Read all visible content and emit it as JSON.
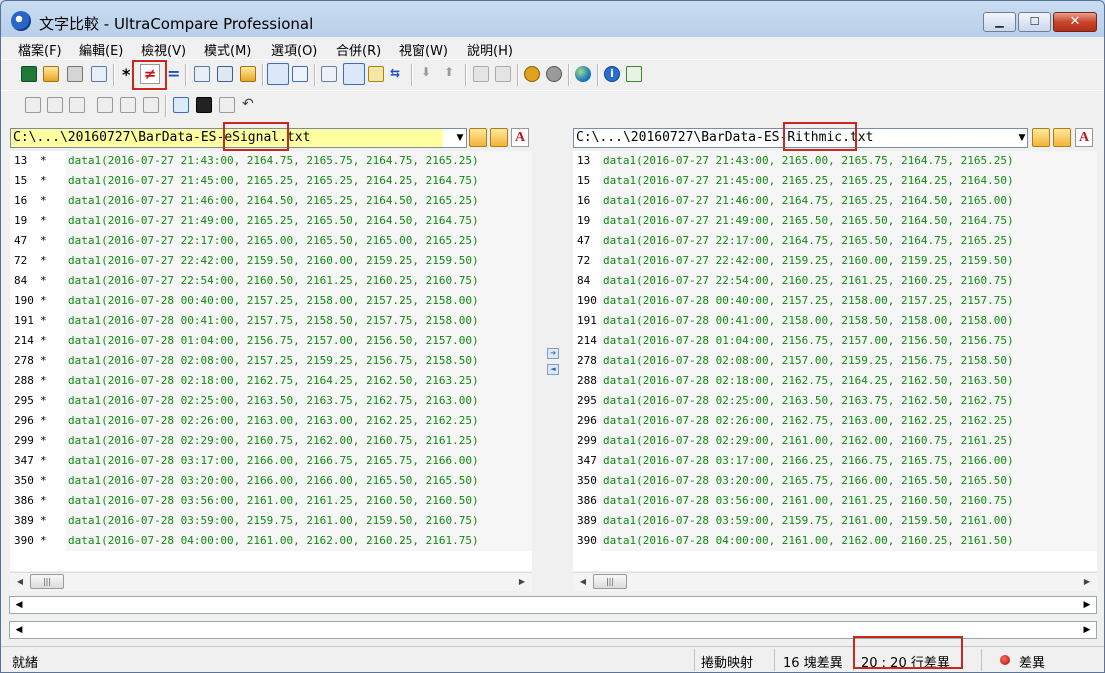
{
  "window": {
    "title": "文字比較 - UltraCompare Professional"
  },
  "menu": [
    "檔案(F)",
    "編輯(E)",
    "檢視(V)",
    "模式(M)",
    "選項(O)",
    "合併(R)",
    "視窗(W)",
    "說明(H)"
  ],
  "left_pane": {
    "path": "C:\\...\\20160727\\BarData-ES-eSignal.txt",
    "rows": [
      {
        "line": "13",
        "mark": "*",
        "text": "data1(2016-07-27 21:43:00, 2164.75, 2165.75, 2164.75, 2165.25)"
      },
      {
        "line": "15",
        "mark": "*",
        "text": "data1(2016-07-27 21:45:00, 2165.25, 2165.25, 2164.25, 2164.75)"
      },
      {
        "line": "16",
        "mark": "*",
        "text": "data1(2016-07-27 21:46:00, 2164.50, 2165.25, 2164.50, 2165.25)"
      },
      {
        "line": "19",
        "mark": "*",
        "text": "data1(2016-07-27 21:49:00, 2165.25, 2165.50, 2164.50, 2164.75)"
      },
      {
        "line": "47",
        "mark": "*",
        "text": "data1(2016-07-27 22:17:00, 2165.00, 2165.50, 2165.00, 2165.25)"
      },
      {
        "line": "72",
        "mark": "*",
        "text": "data1(2016-07-27 22:42:00, 2159.50, 2160.00, 2159.25, 2159.50)"
      },
      {
        "line": "84",
        "mark": "*",
        "text": "data1(2016-07-27 22:54:00, 2160.50, 2161.25, 2160.25, 2160.75)"
      },
      {
        "line": "190",
        "mark": "*",
        "text": "data1(2016-07-28 00:40:00, 2157.25, 2158.00, 2157.25, 2158.00)"
      },
      {
        "line": "191",
        "mark": "*",
        "text": "data1(2016-07-28 00:41:00, 2157.75, 2158.50, 2157.75, 2158.00)"
      },
      {
        "line": "214",
        "mark": "*",
        "text": "data1(2016-07-28 01:04:00, 2156.75, 2157.00, 2156.50, 2157.00)"
      },
      {
        "line": "278",
        "mark": "*",
        "text": "data1(2016-07-28 02:08:00, 2157.25, 2159.25, 2156.75, 2158.50)"
      },
      {
        "line": "288",
        "mark": "*",
        "text": "data1(2016-07-28 02:18:00, 2162.75, 2164.25, 2162.50, 2163.25)"
      },
      {
        "line": "295",
        "mark": "*",
        "text": "data1(2016-07-28 02:25:00, 2163.50, 2163.75, 2162.75, 2163.00)"
      },
      {
        "line": "296",
        "mark": "*",
        "text": "data1(2016-07-28 02:26:00, 2163.00, 2163.00, 2162.25, 2162.25)"
      },
      {
        "line": "299",
        "mark": "*",
        "text": "data1(2016-07-28 02:29:00, 2160.75, 2162.00, 2160.75, 2161.25)"
      },
      {
        "line": "347",
        "mark": "*",
        "text": "data1(2016-07-28 03:17:00, 2166.00, 2166.75, 2165.75, 2166.00)"
      },
      {
        "line": "350",
        "mark": "*",
        "text": "data1(2016-07-28 03:20:00, 2166.00, 2166.00, 2165.50, 2165.50)"
      },
      {
        "line": "386",
        "mark": "*",
        "text": "data1(2016-07-28 03:56:00, 2161.00, 2161.25, 2160.50, 2160.50)"
      },
      {
        "line": "389",
        "mark": "*",
        "text": "data1(2016-07-28 03:59:00, 2159.75, 2161.00, 2159.50, 2160.75)"
      },
      {
        "line": "390",
        "mark": "*",
        "text": "data1(2016-07-28 04:00:00, 2161.00, 2162.00, 2160.25, 2161.75)"
      }
    ]
  },
  "right_pane": {
    "path": "C:\\...\\20160727\\BarData-ES-Rithmic.txt",
    "rows": [
      {
        "line": "13",
        "text": "data1(2016-07-27 21:43:00, 2165.00, 2165.75, 2164.75, 2165.25)"
      },
      {
        "line": "15",
        "text": "data1(2016-07-27 21:45:00, 2165.25, 2165.25, 2164.25, 2164.50)"
      },
      {
        "line": "16",
        "text": "data1(2016-07-27 21:46:00, 2164.75, 2165.25, 2164.50, 2165.00)"
      },
      {
        "line": "19",
        "text": "data1(2016-07-27 21:49:00, 2165.50, 2165.50, 2164.50, 2164.75)"
      },
      {
        "line": "47",
        "text": "data1(2016-07-27 22:17:00, 2164.75, 2165.50, 2164.75, 2165.25)"
      },
      {
        "line": "72",
        "text": "data1(2016-07-27 22:42:00, 2159.25, 2160.00, 2159.25, 2159.50)"
      },
      {
        "line": "84",
        "text": "data1(2016-07-27 22:54:00, 2160.25, 2161.25, 2160.25, 2160.75)"
      },
      {
        "line": "190",
        "text": "data1(2016-07-28 00:40:00, 2157.25, 2158.00, 2157.25, 2157.75)"
      },
      {
        "line": "191",
        "text": "data1(2016-07-28 00:41:00, 2158.00, 2158.50, 2158.00, 2158.00)"
      },
      {
        "line": "214",
        "text": "data1(2016-07-28 01:04:00, 2156.75, 2157.00, 2156.50, 2156.75)"
      },
      {
        "line": "278",
        "text": "data1(2016-07-28 02:08:00, 2157.00, 2159.25, 2156.75, 2158.50)"
      },
      {
        "line": "288",
        "text": "data1(2016-07-28 02:18:00, 2162.75, 2164.25, 2162.50, 2163.50)"
      },
      {
        "line": "295",
        "text": "data1(2016-07-28 02:25:00, 2163.50, 2163.75, 2162.50, 2162.75)"
      },
      {
        "line": "296",
        "text": "data1(2016-07-28 02:26:00, 2162.75, 2163.00, 2162.25, 2162.25)"
      },
      {
        "line": "299",
        "text": "data1(2016-07-28 02:29:00, 2161.00, 2162.00, 2160.75, 2161.25)"
      },
      {
        "line": "347",
        "text": "data1(2016-07-28 03:17:00, 2166.25, 2166.75, 2165.75, 2166.00)"
      },
      {
        "line": "350",
        "text": "data1(2016-07-28 03:20:00, 2165.75, 2166.00, 2165.50, 2165.50)"
      },
      {
        "line": "386",
        "text": "data1(2016-07-28 03:56:00, 2161.00, 2161.25, 2160.50, 2160.75)"
      },
      {
        "line": "389",
        "text": "data1(2016-07-28 03:59:00, 2159.75, 2161.00, 2159.50, 2161.00)"
      },
      {
        "line": "390",
        "text": "data1(2016-07-28 04:00:00, 2161.00, 2162.00, 2160.25, 2161.50)"
      }
    ]
  },
  "status": {
    "ready": "就緒",
    "scroll_map": "捲動映射",
    "blocks": "16 塊差異",
    "lines": "20 : 20 行差異",
    "diff": "差異"
  },
  "colors": {
    "text_green": "#108a10",
    "highlight_red": "#c8281e",
    "path_yellow": "#ffffa0"
  }
}
